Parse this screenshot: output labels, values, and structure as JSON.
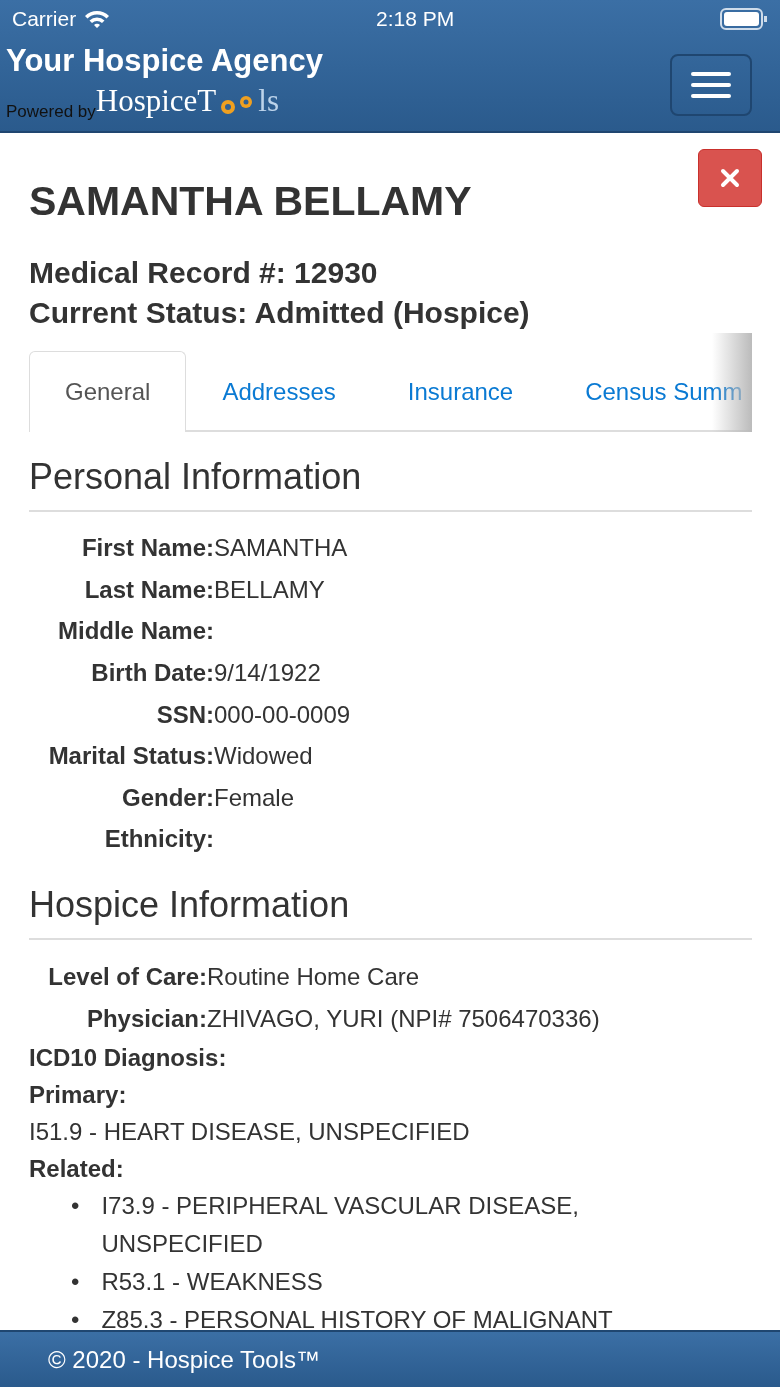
{
  "status_bar": {
    "carrier": "Carrier",
    "time": "2:18 PM"
  },
  "navbar": {
    "title": "Your Hospice Agency",
    "powered_by": "Powered by",
    "brand": "HospiceT",
    "brand_end": "ls"
  },
  "patient": {
    "name": "SAMANTHA BELLAMY",
    "record": "Medical Record #: 12930",
    "status": "Current Status: Admitted (Hospice)"
  },
  "tabs": [
    {
      "label": "General",
      "selected": true
    },
    {
      "label": "Addresses",
      "selected": false
    },
    {
      "label": "Insurance",
      "selected": false
    },
    {
      "label": "Census Summ",
      "selected": false
    }
  ],
  "personal": {
    "heading": "Personal Information",
    "fields": [
      {
        "label": "First Name:",
        "value": "SAMANTHA"
      },
      {
        "label": "Last Name:",
        "value": "BELLAMY"
      },
      {
        "label": "Middle Name:"
      },
      {
        "label": "Birth Date:",
        "value": "9/14/1922"
      },
      {
        "label": "SSN:",
        "value": "000-00-0009"
      },
      {
        "label": "Marital Status:",
        "value": "Widowed"
      },
      {
        "label": "Gender:",
        "value": "Female"
      },
      {
        "label": "Ethnicity:"
      }
    ]
  },
  "hospice": {
    "heading": "Hospice Information",
    "fields": [
      {
        "label": "Level of Care:",
        "value": "Routine Home Care"
      },
      {
        "label": "Physician:",
        "value": "ZHIVAGO, YURI (NPI# 7506470336)"
      }
    ],
    "diagnosis_label": "ICD10 Diagnosis:",
    "primary_label": "Primary:",
    "primary": "I51.9 - HEART DISEASE, UNSPECIFIED",
    "related_label": "Related:",
    "related": [
      {
        "bullet": "•",
        "text": "I73.9 - PERIPHERAL VASCULAR DISEASE, UNSPECIFIED"
      },
      {
        "bullet": "•",
        "text": "R53.1 - WEAKNESS"
      },
      {
        "bullet": "•",
        "text": "Z85.3 - PERSONAL HISTORY OF MALIGNANT"
      }
    ]
  },
  "footer": "© 2020 - Hospice Tools™"
}
